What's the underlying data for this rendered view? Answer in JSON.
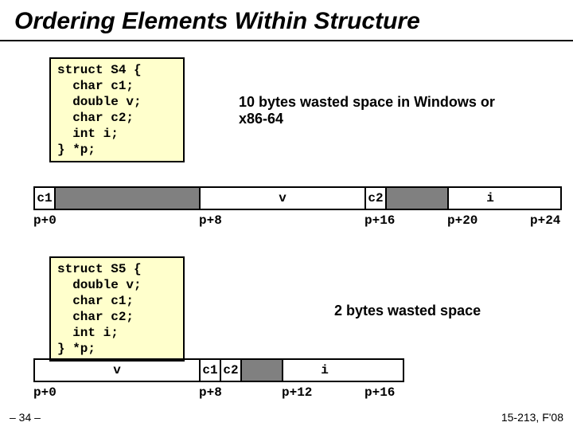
{
  "title": "Ordering Elements Within Structure",
  "code1": "struct S4 {\n  char c1;\n  double v;\n  char c2;\n  int i;\n} *p;",
  "note1": "10 bytes wasted space in Windows or x86-64",
  "diag1": {
    "cells": {
      "c1": "c1",
      "v": "v",
      "c2": "c2",
      "i": "i"
    },
    "offsets": {
      "o0": "p+0",
      "o8": "p+8",
      "o16": "p+16",
      "o20": "p+20",
      "o24": "p+24"
    }
  },
  "code2": "struct S5 {\n  double v;\n  char c1;\n  char c2;\n  int i;\n} *p;",
  "note2": "2 bytes wasted space",
  "diag2": {
    "cells": {
      "v": "v",
      "c1": "c1",
      "c2": "c2",
      "i": "i"
    },
    "offsets": {
      "o0": "p+0",
      "o8": "p+8",
      "o12": "p+12",
      "o16": "p+16"
    }
  },
  "footer": {
    "left": "– 34 –",
    "right": "15-213, F'08"
  }
}
